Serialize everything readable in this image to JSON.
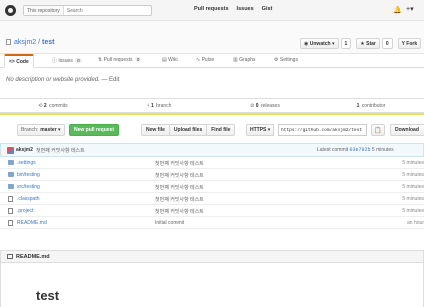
{
  "header": {
    "scope_label": "This repository",
    "search_placeholder": "Search",
    "nav": [
      "Pull requests",
      "Issues",
      "Gist"
    ],
    "bell": "🔔",
    "plus": "+▾"
  },
  "repo": {
    "owner": "aksjm2",
    "separator": "/",
    "name": "test",
    "unwatch_label": "Unwatch ▾",
    "watch_count": "1",
    "star_label": "★ Star",
    "star_count": "0",
    "fork_label": "Y Fork"
  },
  "tabs": [
    {
      "label": "<> Code"
    },
    {
      "label": "Issues",
      "count": "0"
    },
    {
      "label": "Pull requests",
      "count": "0"
    },
    {
      "label": "Wiki"
    },
    {
      "label": "Pulse"
    },
    {
      "label": "Graphs"
    },
    {
      "label": "Settings"
    }
  ],
  "description": {
    "text": "No description or website provided.",
    "edit": "— Edit"
  },
  "summary": {
    "commits_n": "2",
    "commits_label": "commits",
    "branch_n": "1",
    "branch_label": "branch",
    "releases_n": "0",
    "releases_label": "releases",
    "contrib_n": "1",
    "contrib_label": "contributor"
  },
  "filenav": {
    "branch_prefix": "Branch:",
    "branch_name": "master ▾",
    "new_pr": "New pull request",
    "new_file": "New file",
    "upload": "Upload files",
    "find": "Find file",
    "https": "HTTPS ▾",
    "clone_url": "https://github.com/aksjm2/test",
    "download": "Download"
  },
  "commit_tease": {
    "author": "aksjm2",
    "message": "첫번째 커밋사항 테스트",
    "latest_label": "Latest commit",
    "sha": "03e792b",
    "age": "5 minutes"
  },
  "files": [
    {
      "type": "dir",
      "name": ".settings",
      "message": "첫번째 커밋사항 테스트",
      "age": "5 minutes"
    },
    {
      "type": "dir",
      "name": "bin/testing",
      "message": "첫번째 커밋사항 테스트",
      "age": "5 minutes"
    },
    {
      "type": "dir",
      "name": "src/testing",
      "message": "첫번째 커밋사항 테스트",
      "age": "5 minutes"
    },
    {
      "type": "file",
      "name": ".classpath",
      "message": "첫번째 커밋사항 테스트",
      "age": "5 minutes"
    },
    {
      "type": "file",
      "name": ".project",
      "message": "첫번째 커밋사항 테스트",
      "age": "5 minutes"
    },
    {
      "type": "file",
      "name": "README.md",
      "message": "Initial commit",
      "age": "an hour"
    }
  ],
  "readme": {
    "header": "README.md",
    "title": "test"
  },
  "colors": {
    "link": "#4078c0",
    "green": "#5cb85c",
    "tab_accent": "#d26911",
    "lang_bar": "#f1e05a"
  }
}
